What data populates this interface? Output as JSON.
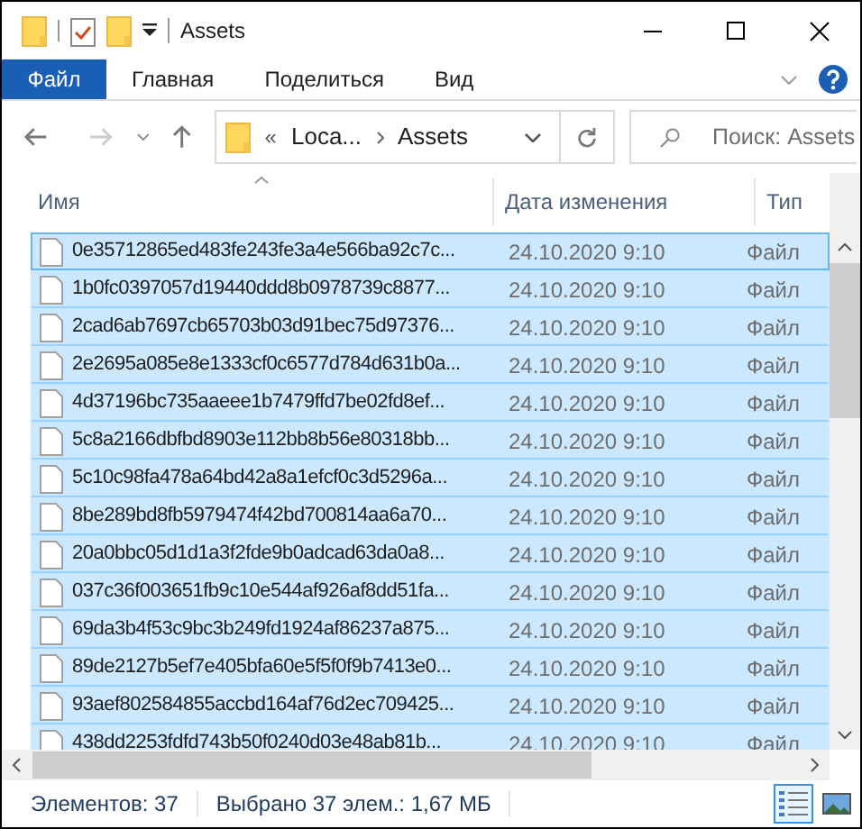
{
  "window": {
    "title": "Assets"
  },
  "ribbon_tabs": [
    {
      "label": "Файл",
      "selected": true
    },
    {
      "label": "Главная",
      "selected": false
    },
    {
      "label": "Поделиться",
      "selected": false
    },
    {
      "label": "Вид",
      "selected": false
    }
  ],
  "address": {
    "prefix": "«",
    "crumbs": [
      "Loca...",
      "Assets"
    ]
  },
  "search": {
    "placeholder": "Поиск: Assets"
  },
  "columns": [
    "Имя",
    "Дата изменения",
    "Тип"
  ],
  "rows": [
    {
      "name": "0e35712865ed483fe243fe3a4e566ba92c7c...",
      "date": "24.10.2020 9:10",
      "type": "Файл",
      "selected": true,
      "focused": true
    },
    {
      "name": "1b0fc0397057d19440ddd8b0978739c8877...",
      "date": "24.10.2020 9:10",
      "type": "Файл",
      "selected": true,
      "focused": false
    },
    {
      "name": "2cad6ab7697cb65703b03d91bec75d97376...",
      "date": "24.10.2020 9:10",
      "type": "Файл",
      "selected": true,
      "focused": false
    },
    {
      "name": "2e2695a085e8e1333cf0c6577d784d631b0a...",
      "date": "24.10.2020 9:10",
      "type": "Файл",
      "selected": true,
      "focused": false
    },
    {
      "name": "4d37196bc735aaeee1b7479ffd7be02fd8ef...",
      "date": "24.10.2020 9:10",
      "type": "Файл",
      "selected": true,
      "focused": false
    },
    {
      "name": "5c8a2166dbfbd8903e112bb8b56e80318bb...",
      "date": "24.10.2020 9:10",
      "type": "Файл",
      "selected": true,
      "focused": false
    },
    {
      "name": "5c10c98fa478a64bd42a8a1efcf0c3d5296a...",
      "date": "24.10.2020 9:10",
      "type": "Файл",
      "selected": true,
      "focused": false
    },
    {
      "name": "8be289bd8fb5979474f42bd700814aa6a70...",
      "date": "24.10.2020 9:10",
      "type": "Файл",
      "selected": true,
      "focused": false
    },
    {
      "name": "20a0bbc05d1d1a3f2fde9b0adcad63da0a8...",
      "date": "24.10.2020 9:10",
      "type": "Файл",
      "selected": true,
      "focused": false
    },
    {
      "name": "037c36f003651fb9c10e544af926af8dd51fa...",
      "date": "24.10.2020 9:10",
      "type": "Файл",
      "selected": true,
      "focused": false
    },
    {
      "name": "69da3b4f53c9bc3b249fd1924af86237a875...",
      "date": "24.10.2020 9:10",
      "type": "Файл",
      "selected": true,
      "focused": false
    },
    {
      "name": "89de2127b5ef7e405bfa60e5f5f0f9b7413e0...",
      "date": "24.10.2020 9:10",
      "type": "Файл",
      "selected": true,
      "focused": false
    },
    {
      "name": "93aef802584855accbd164af76d2ec709425...",
      "date": "24.10.2020 9:10",
      "type": "Файл",
      "selected": true,
      "focused": false
    },
    {
      "name": "438dd2253fdfd743b50f0240d03e48ab81b...",
      "date": "24.10.2020 9:10",
      "type": "Файл",
      "selected": true,
      "focused": false
    }
  ],
  "status_bar": {
    "count": "Элементов: 37",
    "selection": "Выбрано 37 элем.: 1,67 МБ"
  },
  "view_buttons": [
    {
      "kind": "details",
      "selected": true
    },
    {
      "kind": "thumbnails",
      "selected": false
    }
  ]
}
